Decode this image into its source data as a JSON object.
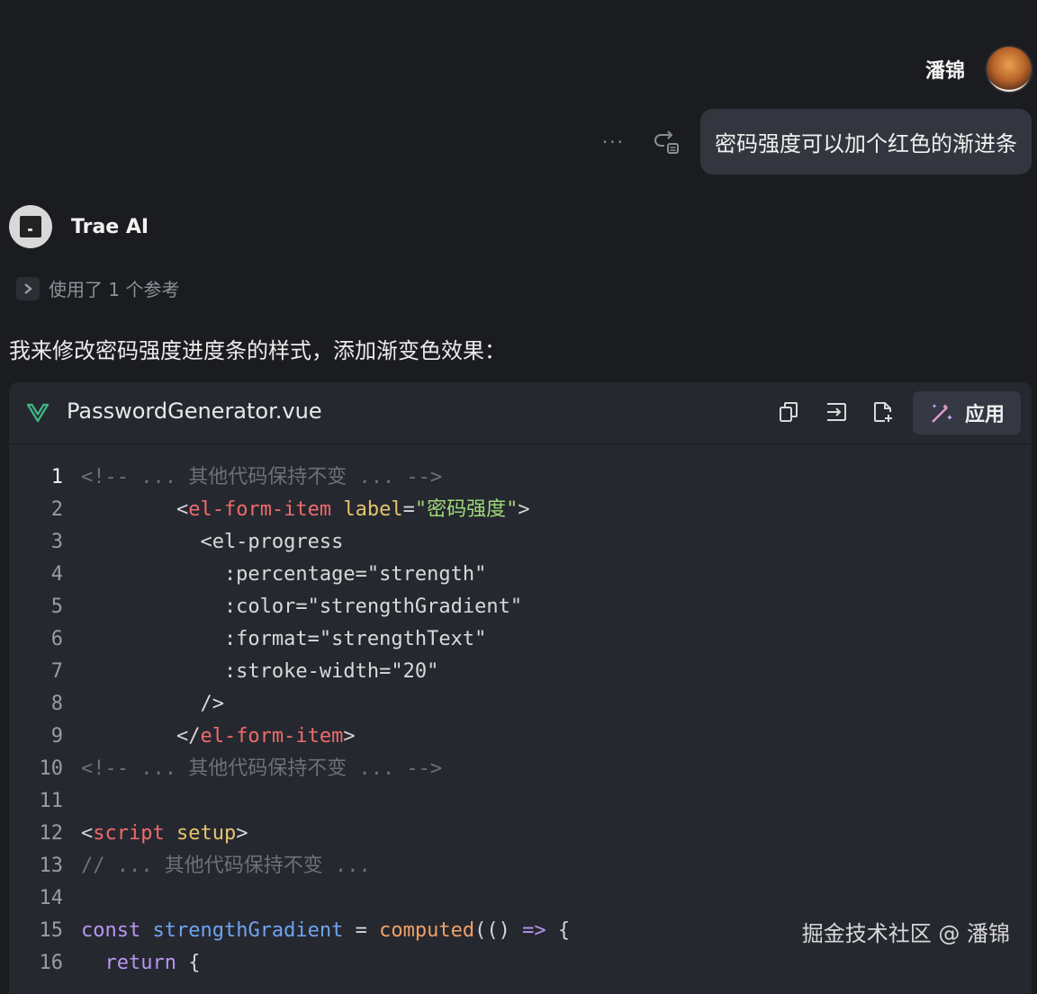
{
  "user": {
    "name": "潘锦"
  },
  "message": {
    "text": "密码强度可以加个红色的渐进条",
    "more": "···"
  },
  "assistant": {
    "name": "Trae AI",
    "refs_label": "使用了 1 个参考",
    "intro": "我来修改密码强度进度条的样式，添加渐变色效果："
  },
  "code_block": {
    "filename": "PasswordGenerator.vue",
    "apply_label": "应用",
    "lines": [
      {
        "n": "1",
        "tokens": [
          {
            "t": "<!-- ... 其他代码保持不变 ... -->",
            "c": "com"
          }
        ]
      },
      {
        "n": "2",
        "tokens": [
          {
            "t": "        <",
            "c": "pun"
          },
          {
            "t": "el-form-item",
            "c": "tag"
          },
          {
            "t": " ",
            "c": "pun"
          },
          {
            "t": "label",
            "c": "attr"
          },
          {
            "t": "=",
            "c": "pun"
          },
          {
            "t": "\"密码强度\"",
            "c": "str"
          },
          {
            "t": ">",
            "c": "pun"
          }
        ]
      },
      {
        "n": "3",
        "tokens": [
          {
            "t": "          <el-progress",
            "c": "txt"
          }
        ]
      },
      {
        "n": "4",
        "tokens": [
          {
            "t": "            :percentage=\"strength\"",
            "c": "txt"
          }
        ]
      },
      {
        "n": "5",
        "tokens": [
          {
            "t": "            :color=\"strengthGradient\"",
            "c": "txt"
          }
        ]
      },
      {
        "n": "6",
        "tokens": [
          {
            "t": "            :format=\"strengthText\"",
            "c": "txt"
          }
        ]
      },
      {
        "n": "7",
        "tokens": [
          {
            "t": "            :stroke-width=\"20\"",
            "c": "txt"
          }
        ]
      },
      {
        "n": "8",
        "tokens": [
          {
            "t": "          />",
            "c": "txt"
          }
        ]
      },
      {
        "n": "9",
        "tokens": [
          {
            "t": "        </",
            "c": "pun"
          },
          {
            "t": "el-form-item",
            "c": "tag"
          },
          {
            "t": ">",
            "c": "pun"
          }
        ]
      },
      {
        "n": "10",
        "tokens": [
          {
            "t": "<!-- ... 其他代码保持不变 ... -->",
            "c": "com"
          }
        ]
      },
      {
        "n": "11",
        "tokens": []
      },
      {
        "n": "12",
        "tokens": [
          {
            "t": "<",
            "c": "pun"
          },
          {
            "t": "script",
            "c": "tag"
          },
          {
            "t": " ",
            "c": "pun"
          },
          {
            "t": "setup",
            "c": "attr"
          },
          {
            "t": ">",
            "c": "pun"
          }
        ]
      },
      {
        "n": "13",
        "tokens": [
          {
            "t": "// ... 其他代码保持不变 ...",
            "c": "com"
          }
        ]
      },
      {
        "n": "14",
        "tokens": []
      },
      {
        "n": "15",
        "tokens": [
          {
            "t": "const ",
            "c": "kw"
          },
          {
            "t": "strengthGradient",
            "c": "var"
          },
          {
            "t": " = ",
            "c": "pun"
          },
          {
            "t": "computed",
            "c": "fn"
          },
          {
            "t": "(() ",
            "c": "pun"
          },
          {
            "t": "=>",
            "c": "kw"
          },
          {
            "t": " {",
            "c": "pun"
          }
        ]
      },
      {
        "n": "16",
        "tokens": [
          {
            "t": "  return",
            "c": "kw"
          },
          {
            "t": " {",
            "c": "pun"
          }
        ]
      }
    ]
  },
  "watermark": "掘金技术社区 @ 潘锦",
  "colors": {
    "background": "#1b1c20",
    "bubble": "#34363f",
    "code_bg": "#262830",
    "vue_green": "#41b883",
    "apply_accent": "#e59bd0"
  },
  "icons": [
    "more-icon",
    "resend-icon",
    "chevron-right-icon",
    "vue-logo-icon",
    "copy-icon",
    "insert-icon",
    "new-file-icon",
    "magic-wand-icon"
  ]
}
